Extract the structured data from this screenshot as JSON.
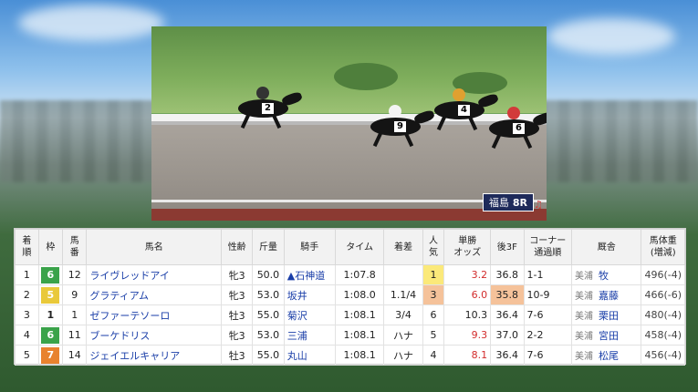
{
  "video": {
    "track_label": "福島",
    "race_number": "8R",
    "cloth_numbers": [
      "2",
      "9",
      "4",
      "6"
    ]
  },
  "table": {
    "headers": [
      "着順",
      "枠",
      "馬番",
      "馬名",
      "性齢",
      "斤量",
      "騎手",
      "タイム",
      "着差",
      "人気",
      "単勝オッズ",
      "後3F",
      "コーナー通過順",
      "厩舎",
      "馬体重(増減)"
    ],
    "rows": [
      {
        "rank": "1",
        "frame": "6",
        "frame_color": "#3aa34a",
        "num": "12",
        "name": "ライヴレッドアイ",
        "sexage": "牝3",
        "weight": "50.0",
        "jockey": "▲石神道",
        "time": "1:07.8",
        "margin": "",
        "pop": "1",
        "odds": "3.2",
        "last3f": "36.8",
        "corner": "1-1",
        "region": "美浦",
        "trainer": "牧",
        "bodyweight": "496(-4)"
      },
      {
        "rank": "2",
        "frame": "5",
        "frame_color": "#e9c93a",
        "num": "9",
        "name": "グラティアム",
        "sexage": "牝3",
        "weight": "53.0",
        "jockey": "坂井",
        "time": "1:08.0",
        "margin": "1.1/4",
        "pop": "3",
        "odds": "6.0",
        "last3f": "35.8",
        "corner": "10-9",
        "region": "美浦",
        "trainer": "嘉藤",
        "bodyweight": "466(-6)"
      },
      {
        "rank": "3",
        "frame": "1",
        "frame_color": "#ffffff",
        "num": "1",
        "name": "ゼファーテソーロ",
        "sexage": "牡3",
        "weight": "55.0",
        "jockey": "菊沢",
        "time": "1:08.1",
        "margin": "3/4",
        "pop": "6",
        "odds": "10.3",
        "last3f": "36.4",
        "corner": "7-6",
        "region": "美浦",
        "trainer": "栗田",
        "bodyweight": "480(-4)"
      },
      {
        "rank": "4",
        "frame": "6",
        "frame_color": "#3aa34a",
        "num": "11",
        "name": "ブーケドリス",
        "sexage": "牝3",
        "weight": "53.0",
        "jockey": "三浦",
        "time": "1:08.1",
        "margin": "ハナ",
        "pop": "5",
        "odds": "9.3",
        "last3f": "37.0",
        "corner": "2-2",
        "region": "美浦",
        "trainer": "宮田",
        "bodyweight": "458(-4)"
      },
      {
        "rank": "5",
        "frame": "7",
        "frame_color": "#e8822e",
        "num": "14",
        "name": "ジェイエルキャリア",
        "sexage": "牡3",
        "weight": "55.0",
        "jockey": "丸山",
        "time": "1:08.1",
        "margin": "ハナ",
        "pop": "4",
        "odds": "8.1",
        "last3f": "36.4",
        "corner": "7-6",
        "region": "美浦",
        "trainer": "松尾",
        "bodyweight": "456(-4)"
      }
    ]
  }
}
